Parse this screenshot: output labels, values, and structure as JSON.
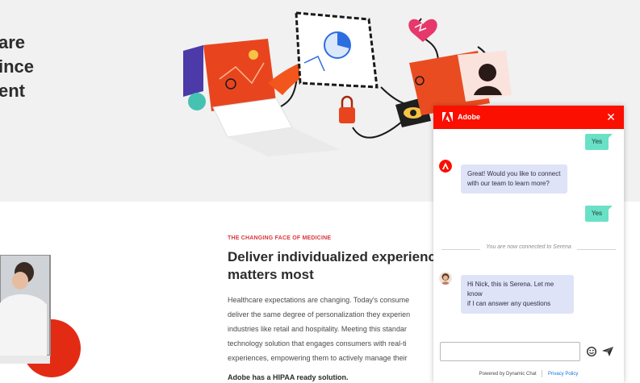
{
  "hero": {
    "heading_lines": [
      "are",
      "ince",
      "ent"
    ]
  },
  "section": {
    "eyebrow": "THE CHANGING FACE OF MEDICINE",
    "title_line1": "Deliver individualized experiences w",
    "title_line2": "matters most",
    "body_lines": [
      "Healthcare expectations are changing. Today's consume",
      "deliver the same degree of personalization they experien",
      "industries like retail and hospitality. Meeting this standar",
      "technology solution that engages consumers with real-ti",
      "experiences, empowering them to actively manage their"
    ],
    "hipaa": "Adobe has a HIPAA ready solution."
  },
  "chat": {
    "title": "Adobe",
    "close_glyph": "✕",
    "messages": [
      {
        "from": "user",
        "text": "Yes"
      },
      {
        "from": "bot",
        "line1": "Great! Would you like to connect",
        "line2": "with our team to learn more?"
      },
      {
        "from": "user",
        "text": "Yes"
      },
      {
        "from": "agent",
        "line1": "Hi Nick, this is Serena. Let me know",
        "line2": "if I can answer any questions"
      }
    ],
    "connected_text": "You are now connected to Serena",
    "input_value": "",
    "input_placeholder": "",
    "footer_powered": "Powered by Dynamic Chat",
    "footer_privacy": "Privacy Policy",
    "icons": {
      "close": "close-icon",
      "emoji": "emoji-icon",
      "send": "send-icon",
      "logo": "adobe-logo-icon"
    }
  },
  "colors": {
    "brand_red": "#fa0f00",
    "user_bubble": "#69e1c6",
    "bot_bubble": "#dfe3f7",
    "eyebrow_red": "#d7373f",
    "link_blue": "#1473e6"
  }
}
